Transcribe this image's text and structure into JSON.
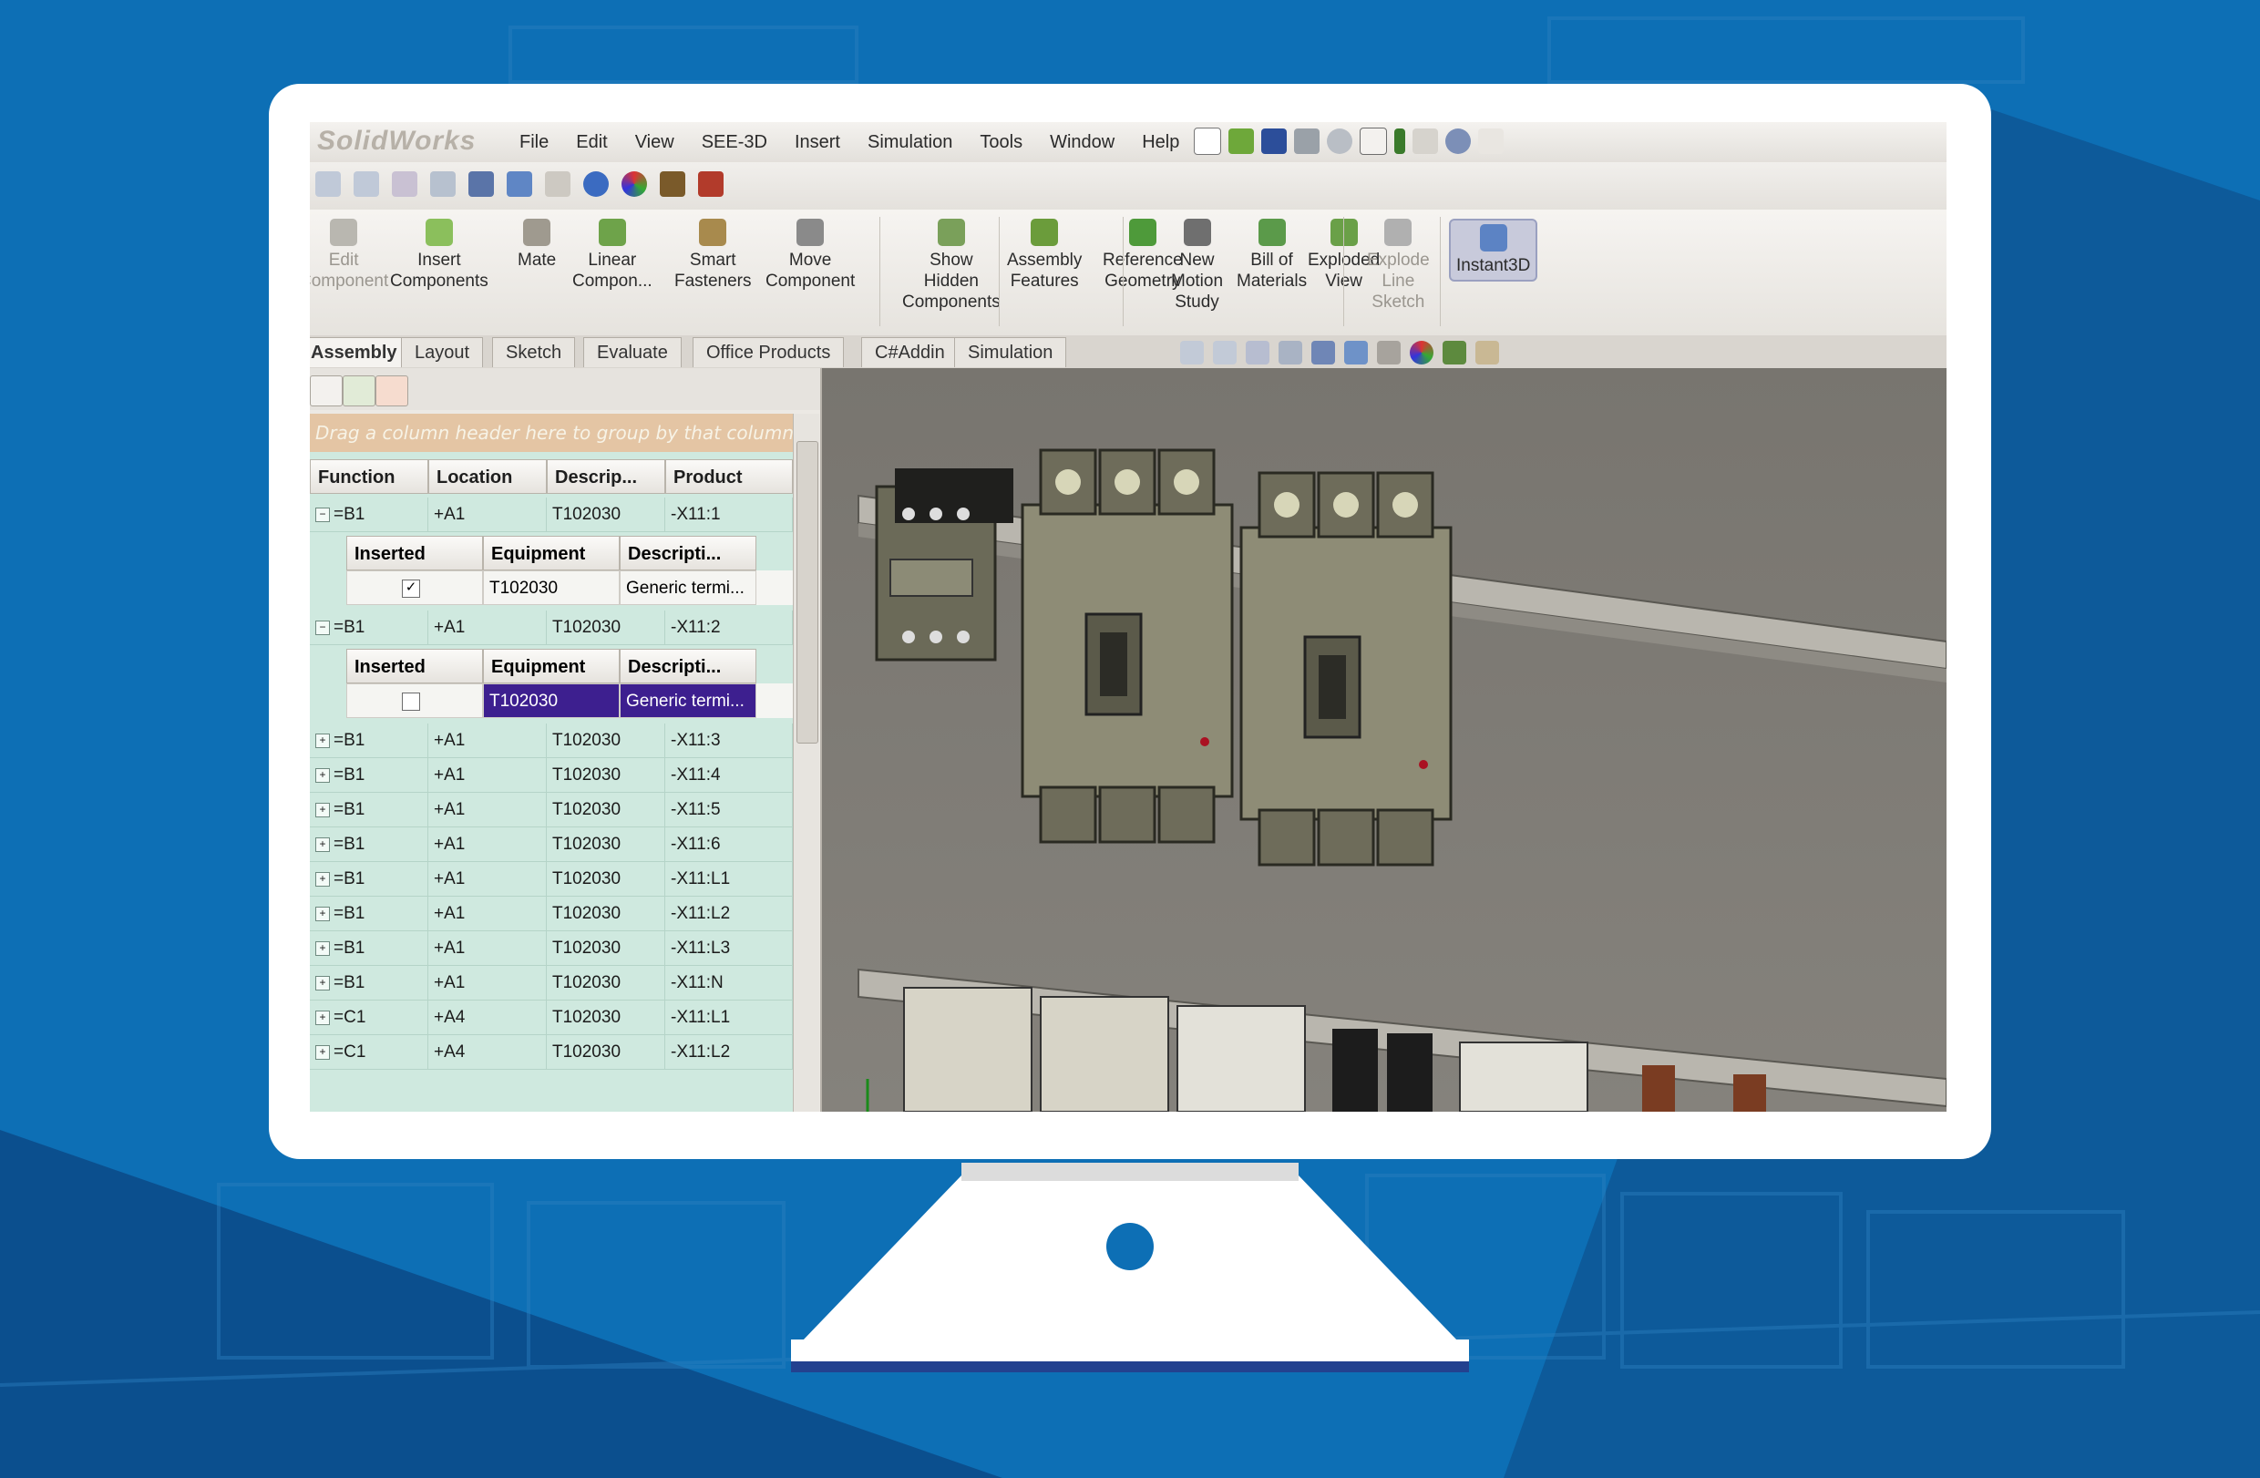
{
  "app": {
    "logo": "SolidWorks",
    "menu": [
      "File",
      "Edit",
      "View",
      "SEE-3D",
      "Insert",
      "Simulation",
      "Tools",
      "Window",
      "Help"
    ]
  },
  "commands": [
    {
      "label": "Edit\nComponent",
      "state": "disabled"
    },
    {
      "label": "Insert\nComponents",
      "state": "normal"
    },
    {
      "label": "Mate",
      "state": "normal"
    },
    {
      "label": "Linear\nCompon...",
      "state": "normal"
    },
    {
      "label": "Smart\nFasteners",
      "state": "normal"
    },
    {
      "label": "Move\nComponent",
      "state": "normal"
    },
    {
      "label": "Show\nHidden\nComponents",
      "state": "normal"
    },
    {
      "label": "Assembly\nFeatures",
      "state": "normal"
    },
    {
      "label": "Reference\nGeometry",
      "state": "normal"
    },
    {
      "label": "New\nMotion\nStudy",
      "state": "normal"
    },
    {
      "label": "Bill of\nMaterials",
      "state": "normal"
    },
    {
      "label": "Exploded\nView",
      "state": "normal"
    },
    {
      "label": "Explode\nLine\nSketch",
      "state": "disabled"
    },
    {
      "label": "Instant3D",
      "state": "active"
    }
  ],
  "tabs": [
    "Assembly",
    "Layout",
    "Sketch",
    "Evaluate",
    "Office Products",
    "C#Addin",
    "Simulation"
  ],
  "grid": {
    "group_hint": "Drag a column header here to group by that column",
    "columns": [
      "Function",
      "Location",
      "Descrip...",
      "Product"
    ],
    "sub_columns": [
      "Inserted",
      "Equipment",
      "Descripti..."
    ],
    "rows": [
      {
        "f": "=B1",
        "l": "+A1",
        "d": "T102030",
        "p": "-X11:1",
        "exp": "−",
        "sub": {
          "checked": "✓",
          "eq": "T102030",
          "desc": "Generic termi...",
          "sel": false
        }
      },
      {
        "f": "=B1",
        "l": "+A1",
        "d": "T102030",
        "p": "-X11:2",
        "exp": "−",
        "sub": {
          "checked": "",
          "eq": "T102030",
          "desc": "Generic termi...",
          "sel": true
        }
      },
      {
        "f": "=B1",
        "l": "+A1",
        "d": "T102030",
        "p": "-X11:3",
        "exp": "+"
      },
      {
        "f": "=B1",
        "l": "+A1",
        "d": "T102030",
        "p": "-X11:4",
        "exp": "+"
      },
      {
        "f": "=B1",
        "l": "+A1",
        "d": "T102030",
        "p": "-X11:5",
        "exp": "+"
      },
      {
        "f": "=B1",
        "l": "+A1",
        "d": "T102030",
        "p": "-X11:6",
        "exp": "+"
      },
      {
        "f": "=B1",
        "l": "+A1",
        "d": "T102030",
        "p": "-X11:L1",
        "exp": "+"
      },
      {
        "f": "=B1",
        "l": "+A1",
        "d": "T102030",
        "p": "-X11:L2",
        "exp": "+"
      },
      {
        "f": "=B1",
        "l": "+A1",
        "d": "T102030",
        "p": "-X11:L3",
        "exp": "+"
      },
      {
        "f": "=B1",
        "l": "+A1",
        "d": "T102030",
        "p": "-X11:N",
        "exp": "+"
      },
      {
        "f": "=C1",
        "l": "+A4",
        "d": "T102030",
        "p": "-X11:L1",
        "exp": "+"
      },
      {
        "f": "=C1",
        "l": "+A4",
        "d": "T102030",
        "p": "-X11:L2",
        "exp": "+"
      }
    ]
  },
  "colors": {
    "background": "#0f64a4",
    "monitor": "#ffffff",
    "selection": "#3d1f8f",
    "grid": "#cfe9df"
  }
}
